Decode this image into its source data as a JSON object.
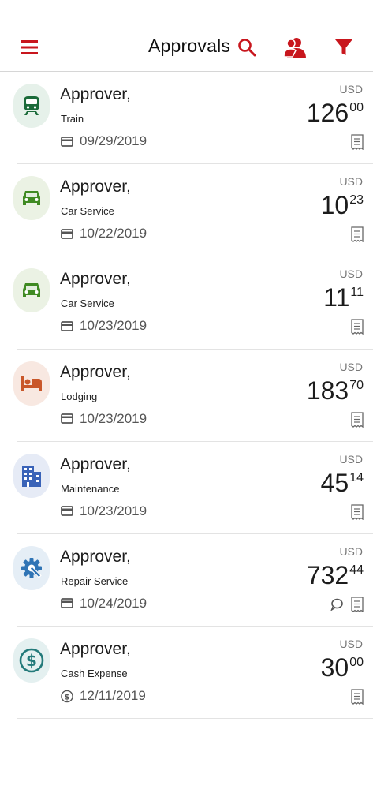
{
  "header": {
    "title": "Approvals",
    "menu_icon": "hamburger-menu-icon",
    "search_icon": "search-icon",
    "delegates_icon": "users-icon",
    "filter_icon": "filter-funnel-icon",
    "accent_color": "#c8161d"
  },
  "items": [
    {
      "name": "Approver,",
      "category": "Train",
      "date": "09/29/2019",
      "currency": "USD",
      "amount_int": "126",
      "amount_dec": "00",
      "icon": "train-icon",
      "icon_color": "#1b6b3a",
      "icon_bg": "#e6f1ea",
      "date_icon": "credit-card-icon",
      "has_comment": false
    },
    {
      "name": "Approver,",
      "category": "Car Service",
      "date": "10/22/2019",
      "currency": "USD",
      "amount_int": "10",
      "amount_dec": "23",
      "icon": "car-icon",
      "icon_color": "#3f8a22",
      "icon_bg": "#ebf2e4",
      "date_icon": "credit-card-icon",
      "has_comment": false
    },
    {
      "name": "Approver,",
      "category": "Car Service",
      "date": "10/23/2019",
      "currency": "USD",
      "amount_int": "11",
      "amount_dec": "11",
      "icon": "car-icon",
      "icon_color": "#3f8a22",
      "icon_bg": "#ebf2e4",
      "date_icon": "credit-card-icon",
      "has_comment": false
    },
    {
      "name": "Approver,",
      "category": "Lodging",
      "date": "10/23/2019",
      "currency": "USD",
      "amount_int": "183",
      "amount_dec": "70",
      "icon": "bed-icon",
      "icon_color": "#c9572a",
      "icon_bg": "#f8e8e1",
      "date_icon": "credit-card-icon",
      "has_comment": false
    },
    {
      "name": "Approver,",
      "category": "Maintenance",
      "date": "10/23/2019",
      "currency": "USD",
      "amount_int": "45",
      "amount_dec": "14",
      "icon": "building-icon",
      "icon_color": "#3a63b8",
      "icon_bg": "#e6ebf6",
      "date_icon": "credit-card-icon",
      "has_comment": false
    },
    {
      "name": "Approver,",
      "category": "Repair Service",
      "date": "10/24/2019",
      "currency": "USD",
      "amount_int": "732",
      "amount_dec": "44",
      "icon": "wrench-gear-icon",
      "icon_color": "#2f74b5",
      "icon_bg": "#e5eef6",
      "date_icon": "credit-card-icon",
      "has_comment": true
    },
    {
      "name": "Approver,",
      "category": "Cash Expense",
      "date": "12/11/2019",
      "currency": "USD",
      "amount_int": "30",
      "amount_dec": "00",
      "icon": "dollar-circle-icon",
      "icon_color": "#237a7a",
      "icon_bg": "#e4f0f0",
      "date_icon": "cash-coin-icon",
      "has_comment": false
    }
  ]
}
